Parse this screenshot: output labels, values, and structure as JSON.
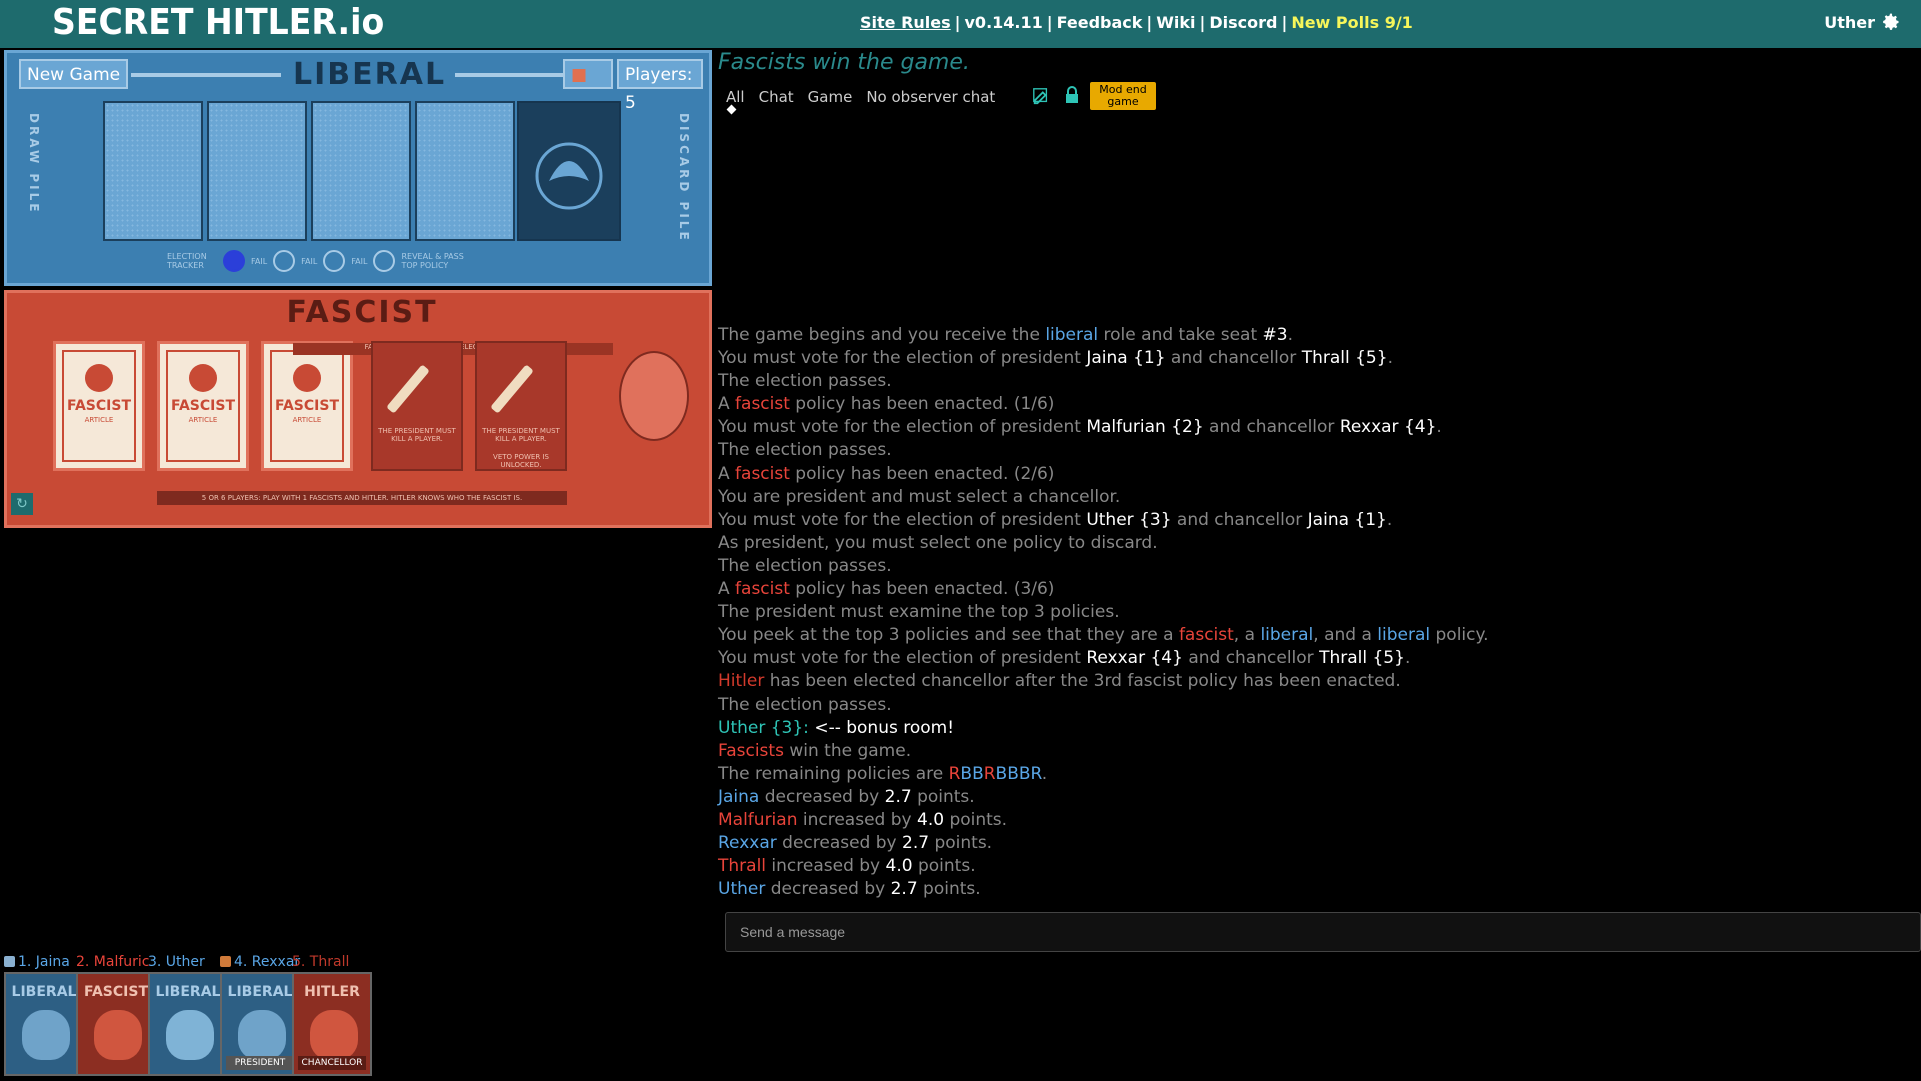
{
  "header": {
    "logo": "SECRET HITLER.io",
    "links": {
      "site_rules": "Site Rules",
      "version": "v0.14.11",
      "feedback": "Feedback",
      "wiki": "Wiki",
      "discord": "Discord",
      "new_polls": "New Polls 9/1"
    },
    "user": "Uther"
  },
  "liberal_board": {
    "new_game": "New Game",
    "title": "LIBERAL",
    "players": "Players: 5",
    "draw_pile": "DRAW PILE",
    "discard_pile": "DISCARD PILE",
    "tracker_label": "ELECTION TRACKER",
    "fail": "FAIL",
    "reveal": "REVEAL & PASS TOP POLICY"
  },
  "fascist_board": {
    "title": "FASCIST",
    "card_label": "FASCIST",
    "card_sub": "ARTICLE",
    "banner": "FASCISTS WIN IF HITLER IS ELECTED CHANCELLOR",
    "slot_note_1": "THE PRESIDENT MUST KILL A PLAYER.",
    "slot_note_2": "THE PRESIDENT MUST KILL A PLAYER.",
    "veto_note": "VETO POWER IS UNLOCKED.",
    "footer": "5 OR 6 PLAYERS: PLAY WITH 1 FASCISTS AND HITLER. HITLER KNOWS WHO THE FASCIST IS."
  },
  "chat": {
    "heading": "Fascists win the game.",
    "tabs": [
      "All",
      "Chat",
      "Game",
      "No observer chat"
    ],
    "mod_end": "Mod end game",
    "placeholder": "Send a message",
    "log": [
      [
        [
          "The game begins and you receive the ",
          "g"
        ],
        [
          "liberal",
          "lib"
        ],
        [
          " role and take seat ",
          "g"
        ],
        [
          "#3",
          "w"
        ],
        [
          ".",
          "g"
        ]
      ],
      [
        [
          "You must vote for the election of president ",
          "g"
        ],
        [
          "Jaina {1}",
          "w"
        ],
        [
          " and chancellor ",
          "g"
        ],
        [
          "Thrall {5}",
          "w"
        ],
        [
          ".",
          "g"
        ]
      ],
      [
        [
          "The election passes.",
          "g"
        ]
      ],
      [
        [
          "A ",
          "g"
        ],
        [
          "fascist",
          "fas"
        ],
        [
          " policy has been enacted. (1/6)",
          "g"
        ]
      ],
      [
        [
          "You must vote for the election of president ",
          "g"
        ],
        [
          "Malfurian {2}",
          "w"
        ],
        [
          " and chancellor ",
          "g"
        ],
        [
          "Rexxar {4}",
          "w"
        ],
        [
          ".",
          "g"
        ]
      ],
      [
        [
          "The election passes.",
          "g"
        ]
      ],
      [
        [
          "A ",
          "g"
        ],
        [
          "fascist",
          "fas"
        ],
        [
          " policy has been enacted. (2/6)",
          "g"
        ]
      ],
      [
        [
          "You are president and must select a chancellor.",
          "g"
        ]
      ],
      [
        [
          "You must vote for the election of president ",
          "g"
        ],
        [
          "Uther {3}",
          "w"
        ],
        [
          " and chancellor ",
          "g"
        ],
        [
          "Jaina {1}",
          "w"
        ],
        [
          ".",
          "g"
        ]
      ],
      [
        [
          "As president, you must select one policy to discard.",
          "g"
        ]
      ],
      [
        [
          "The election passes.",
          "g"
        ]
      ],
      [
        [
          "A ",
          "g"
        ],
        [
          "fascist",
          "fas"
        ],
        [
          " policy has been enacted. (3/6)",
          "g"
        ]
      ],
      [
        [
          "The president must examine the top 3 policies.",
          "g"
        ]
      ],
      [
        [
          "You peek at the top 3 policies and see that they are a ",
          "g"
        ],
        [
          "fascist",
          "fas"
        ],
        [
          ", a ",
          "g"
        ],
        [
          "liberal",
          "lib"
        ],
        [
          ", and a ",
          "g"
        ],
        [
          "liberal",
          "lib"
        ],
        [
          " policy.",
          "g"
        ]
      ],
      [
        [
          "You must vote for the election of president ",
          "g"
        ],
        [
          "Rexxar {4}",
          "w"
        ],
        [
          " and chancellor ",
          "g"
        ],
        [
          "Thrall {5}",
          "w"
        ],
        [
          ".",
          "g"
        ]
      ],
      [
        [
          "Hitler",
          "hit"
        ],
        [
          " has been elected chancellor after the 3rd fascist policy has been enacted.",
          "g"
        ]
      ],
      [
        [
          "The election passes.",
          "g"
        ]
      ],
      [
        [
          "Uther {3}: ",
          "teal"
        ],
        [
          "<-- bonus room!",
          "w"
        ]
      ],
      [
        [
          "Fascists",
          "fas"
        ],
        [
          " win the game.",
          "g"
        ]
      ],
      [
        [
          "The remaining policies are ",
          "g"
        ],
        [
          "R",
          "fas"
        ],
        [
          "BB",
          "lib"
        ],
        [
          "R",
          "fas"
        ],
        [
          "BBBR",
          "lib"
        ],
        [
          ".",
          "g"
        ]
      ],
      [
        [
          "Jaina",
          "lib"
        ],
        [
          " decreased by ",
          "g"
        ],
        [
          "2.7",
          "w"
        ],
        [
          " points.",
          "g"
        ]
      ],
      [
        [
          "Malfurian",
          "fas"
        ],
        [
          " increased by ",
          "g"
        ],
        [
          "4.0",
          "w"
        ],
        [
          " points.",
          "g"
        ]
      ],
      [
        [
          "Rexxar",
          "lib"
        ],
        [
          " decreased by ",
          "g"
        ],
        [
          "2.7",
          "w"
        ],
        [
          " points.",
          "g"
        ]
      ],
      [
        [
          "Thrall",
          "fas"
        ],
        [
          " increased by ",
          "g"
        ],
        [
          "4.0",
          "w"
        ],
        [
          " points.",
          "g"
        ]
      ],
      [
        [
          "Uther",
          "lib"
        ],
        [
          " decreased by ",
          "g"
        ],
        [
          "2.7",
          "w"
        ],
        [
          " points.",
          "g"
        ]
      ]
    ]
  },
  "players": [
    {
      "name": "1. Jaina",
      "role": "LIBERAL",
      "tag": "",
      "color": "#5aa6e6",
      "badge": "#8ab0d0"
    },
    {
      "name": "2. Malfuric",
      "role": "FASCIST",
      "tag": "",
      "color": "#e8443a",
      "badge": ""
    },
    {
      "name": "3. Uther",
      "role": "LIBERAL",
      "tag": "",
      "color": "#5aa6e6",
      "badge": ""
    },
    {
      "name": "4. Rexxar",
      "role": "LIBERAL",
      "tag": "PRESIDENT",
      "color": "#5aa6e6",
      "badge": "#d07a3a"
    },
    {
      "name": "5. Thrall",
      "role": "HITLER",
      "tag": "CHANCELLOR",
      "color": "#c0392b",
      "badge": ""
    }
  ],
  "colors": {
    "topbar": "#1e6b6d",
    "liberal": "#5aa6e6",
    "fascist": "#e8443a",
    "mod_button": "#e8a900"
  }
}
